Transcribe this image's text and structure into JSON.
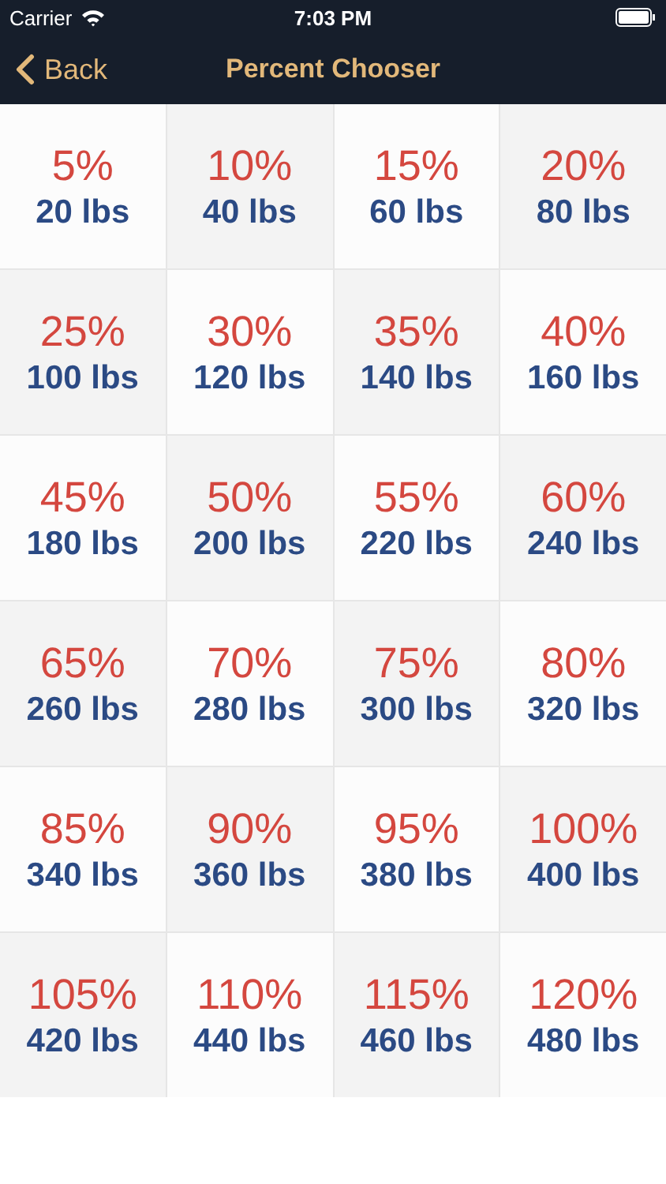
{
  "status_bar": {
    "carrier": "Carrier",
    "time": "7:03 PM"
  },
  "nav": {
    "back": "Back",
    "title": "Percent Chooser"
  },
  "cells": [
    {
      "percent": "5%",
      "weight": "20 lbs"
    },
    {
      "percent": "10%",
      "weight": "40 lbs"
    },
    {
      "percent": "15%",
      "weight": "60 lbs"
    },
    {
      "percent": "20%",
      "weight": "80 lbs"
    },
    {
      "percent": "25%",
      "weight": "100 lbs"
    },
    {
      "percent": "30%",
      "weight": "120 lbs"
    },
    {
      "percent": "35%",
      "weight": "140 lbs"
    },
    {
      "percent": "40%",
      "weight": "160 lbs"
    },
    {
      "percent": "45%",
      "weight": "180 lbs"
    },
    {
      "percent": "50%",
      "weight": "200 lbs"
    },
    {
      "percent": "55%",
      "weight": "220 lbs"
    },
    {
      "percent": "60%",
      "weight": "240 lbs"
    },
    {
      "percent": "65%",
      "weight": "260 lbs"
    },
    {
      "percent": "70%",
      "weight": "280 lbs"
    },
    {
      "percent": "75%",
      "weight": "300 lbs"
    },
    {
      "percent": "80%",
      "weight": "320 lbs"
    },
    {
      "percent": "85%",
      "weight": "340 lbs"
    },
    {
      "percent": "90%",
      "weight": "360 lbs"
    },
    {
      "percent": "95%",
      "weight": "380 lbs"
    },
    {
      "percent": "100%",
      "weight": "400 lbs"
    },
    {
      "percent": "105%",
      "weight": "420 lbs"
    },
    {
      "percent": "110%",
      "weight": "440 lbs"
    },
    {
      "percent": "115%",
      "weight": "460 lbs"
    },
    {
      "percent": "120%",
      "weight": "480 lbs"
    }
  ]
}
